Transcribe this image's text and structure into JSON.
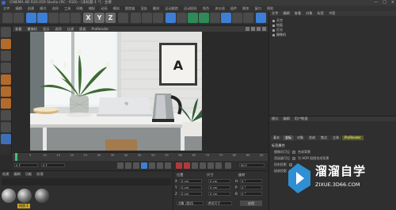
{
  "window": {
    "title": "CINEMA 4D R20.059 Studio (RC - R20) - [未标题-1 *] - 主要",
    "controls": [
      "—",
      "□",
      "×"
    ]
  },
  "menubar": [
    "文件",
    "编辑",
    "创建",
    "模式",
    "选择",
    "工具",
    "网格",
    "捕捉",
    "动画",
    "模拟",
    "跟踪器",
    "渲染",
    "雕刻",
    "运动跟踪",
    "运动图形",
    "角色",
    "流水线",
    "插件",
    "脚本",
    "窗口",
    "帮助"
  ],
  "toolbar": {
    "axis_labels": [
      "X",
      "Y",
      "Z"
    ]
  },
  "viewport": {
    "menu": [
      "查看",
      "摄像机",
      "显示",
      "选项",
      "过滤",
      "面板",
      "ProRender"
    ],
    "poster_letter": "A"
  },
  "timeline": {
    "ticks": [
      "0",
      "5",
      "10",
      "15",
      "20",
      "25",
      "30",
      "35",
      "40",
      "45",
      "50",
      "55",
      "60",
      "65",
      "70",
      "75",
      "80",
      "85",
      "90"
    ],
    "current_frame": "0 F",
    "end_frame": "90 F",
    "frame_end": "0 F"
  },
  "material_panel": {
    "menu": [
      "创建",
      "编辑",
      "功能",
      "纹理"
    ],
    "swatch_label": "材质.1"
  },
  "coord_panel": {
    "headers": [
      "位置",
      "尺寸",
      "旋转"
    ],
    "rows": [
      {
        "axis": "X",
        "pos": "0 cm",
        "size": "0 cm",
        "rot_axis": "H",
        "rot": "0 °"
      },
      {
        "axis": "Y",
        "pos": "0 cm",
        "size": "0 cm",
        "rot_axis": "P",
        "rot": "0 °"
      },
      {
        "axis": "Z",
        "pos": "0 cm",
        "size": "0 cm",
        "rot_axis": "B",
        "rot": "0 °"
      }
    ],
    "mode": "对象 (相对)",
    "size_mode": "绝对尺寸",
    "apply": "应用"
  },
  "object_manager": {
    "tabs": [
      "文件",
      "编辑",
      "查看",
      "对象",
      "标签",
      "书签"
    ],
    "objects": [
      "天空",
      "地面",
      "灯光",
      "摄像机"
    ]
  },
  "attributes": {
    "top_tabs": [
      "模式",
      "编辑",
      "用户数据"
    ],
    "tabs": [
      "基本",
      "坐标",
      "对象",
      "合成",
      "焦点",
      "立体",
      "球面",
      "保护"
    ],
    "highlight_tab": "ProRender",
    "section": "标签属性",
    "rows": [
      {
        "label": "摄像机可见",
        "right": "合成背景"
      },
      {
        "label": "渲染器可见",
        "right": "为 HDR 贴图合成背景"
      },
      {
        "label": "投射投影",
        "right": ""
      },
      {
        "label": "接收投影",
        "right": ""
      }
    ]
  },
  "watermark": {
    "name": "溜溜自学",
    "url": "ZIXUE.3D66.COM"
  },
  "colors": {
    "accent_blue": "#3d7fd6",
    "playhead_green": "#39c26b",
    "watermark": "#2f8fd3"
  }
}
